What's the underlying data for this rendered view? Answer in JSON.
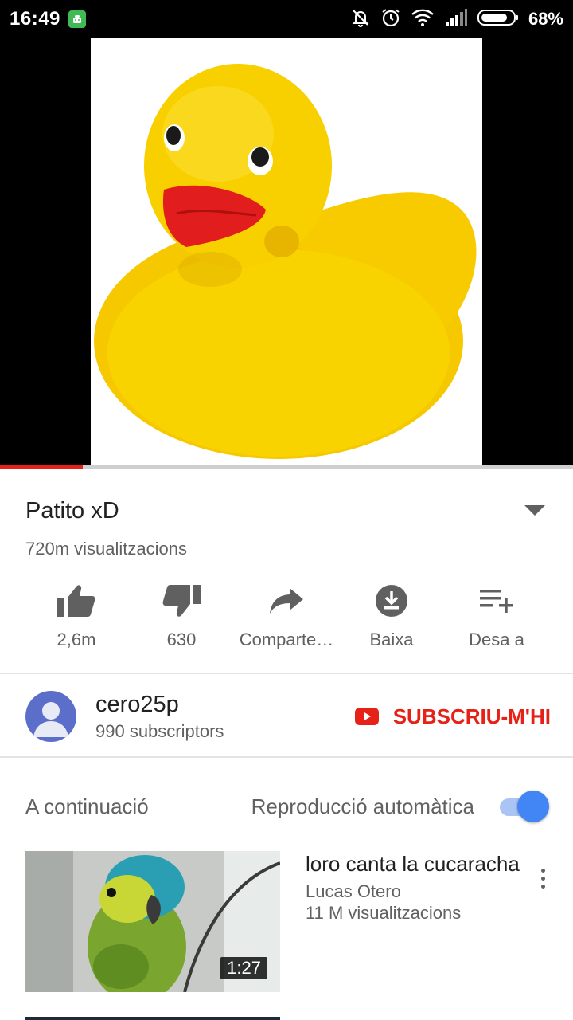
{
  "status_bar": {
    "time": "16:49",
    "battery": "68%",
    "icons": [
      "android-notification-icon",
      "bell-muted-icon",
      "alarm-icon",
      "wifi-icon",
      "signal-icon",
      "battery-icon"
    ]
  },
  "player": {
    "progress": 0.145,
    "progress_color": "#e62117"
  },
  "video": {
    "title": "Patito xD",
    "views": "720m visualitzacions"
  },
  "actions": [
    {
      "icon": "thumbs-up-icon",
      "label": "2,6m"
    },
    {
      "icon": "thumbs-down-icon",
      "label": "630"
    },
    {
      "icon": "share-icon",
      "label": "Comparte…"
    },
    {
      "icon": "download-icon",
      "label": "Baixa"
    },
    {
      "icon": "add-to-playlist-icon",
      "label": "Desa a"
    }
  ],
  "channel": {
    "name": "cero25p",
    "subscribers": "990 subscriptors",
    "subscribe_label": "SUBSCRIU-M'HI"
  },
  "up_next": {
    "label": "A continuació",
    "autoplay_label": "Reproducció automàtica",
    "autoplay_on": true
  },
  "recommendations": [
    {
      "title": "loro canta la cucaracha",
      "channel": "Lucas Otero",
      "views": "11 M visualitzacions",
      "duration": "1:27"
    }
  ],
  "colors": {
    "accent_red": "#e62117",
    "toggle_blue": "#4285f4",
    "avatar_bg": "#5b6ec9"
  }
}
